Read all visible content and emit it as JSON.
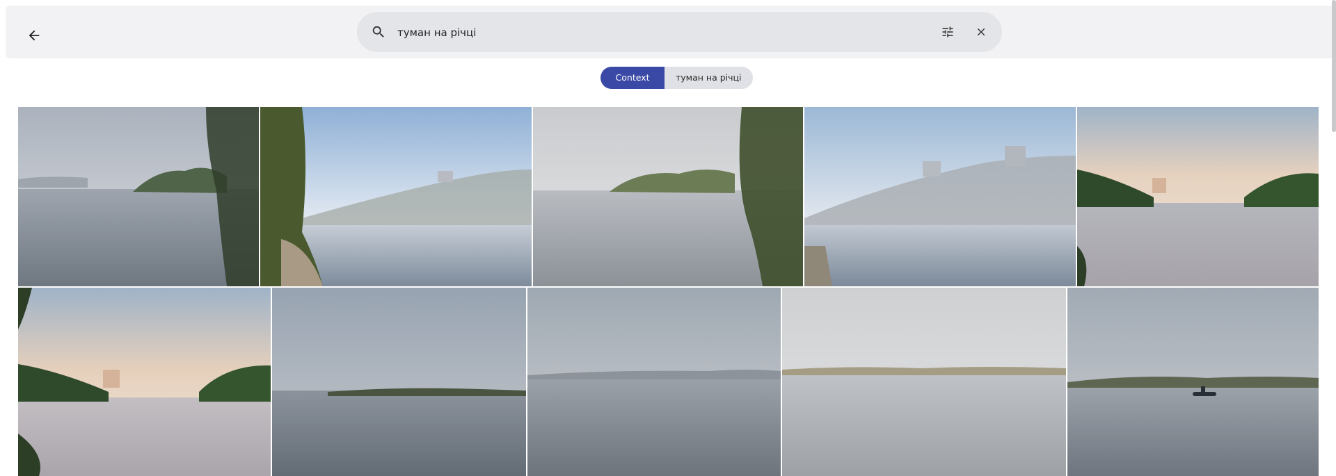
{
  "header": {
    "back_icon": "arrow-back-icon",
    "search": {
      "icon": "search-icon",
      "value": "туман на річці",
      "tune_icon": "tune-icon",
      "clear_icon": "close-icon"
    }
  },
  "filters": {
    "chips": [
      {
        "label": "Context",
        "active": true
      },
      {
        "label": "туман на річці",
        "active": false
      }
    ]
  },
  "results": {
    "rows": [
      [
        {
          "scene": "misty-river-willow"
        },
        {
          "scene": "bright-river-bank-tree"
        },
        {
          "scene": "foggy-river-reeds"
        },
        {
          "scene": "hazy-river-buildings"
        },
        {
          "scene": "dawn-river-city"
        }
      ],
      [
        {
          "scene": "dawn-river-city-left"
        },
        {
          "scene": "dense-fog-island"
        },
        {
          "scene": "grey-fog-water"
        },
        {
          "scene": "pale-fog-reeds"
        },
        {
          "scene": "fog-boat"
        }
      ]
    ]
  },
  "colors": {
    "accent": "#3b49a6",
    "topbar_bg": "#f2f2f4",
    "search_bg": "#e4e5e9",
    "chip_inactive_bg": "#e0e1e6"
  }
}
